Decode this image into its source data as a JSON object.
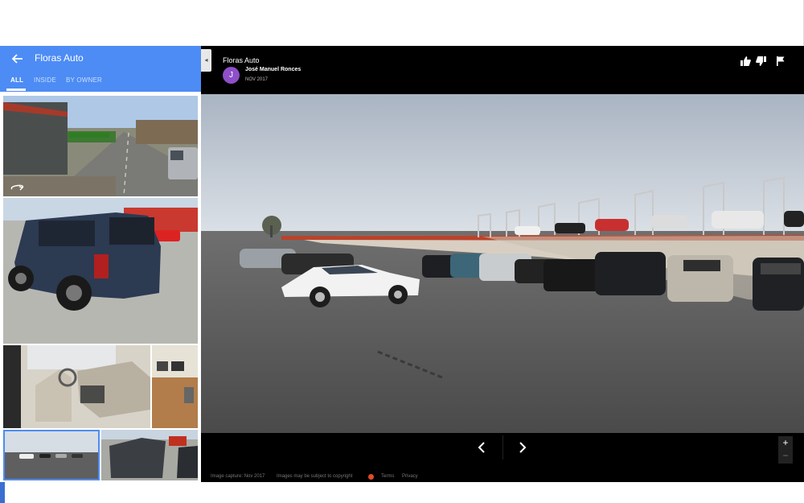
{
  "sidebar": {
    "title": "Floras Auto",
    "tabs": [
      {
        "label": "ALL",
        "active": true
      },
      {
        "label": "INSIDE",
        "active": false
      },
      {
        "label": "BY OWNER",
        "active": false
      }
    ],
    "accent_color": "#4d8cf5"
  },
  "viewer": {
    "title": "Floras Auto",
    "author": "José Manuel Ronces",
    "author_initial": "J",
    "date": "NOV 2017",
    "avatar_color": "#8e4fc9",
    "collapse_glyph": "◂",
    "zoom_in": "+",
    "zoom_out": "−",
    "icons": [
      "thumbs-up-icon",
      "thumbs-down-icon",
      "flag-icon",
      "chevron-left-icon",
      "chevron-right-icon",
      "pano-icon"
    ]
  },
  "footer": {
    "capture": "Image capture: Nov 2017",
    "copyright": "Images may be subject to copyright",
    "terms": "Terms",
    "privacy": "Privacy"
  }
}
